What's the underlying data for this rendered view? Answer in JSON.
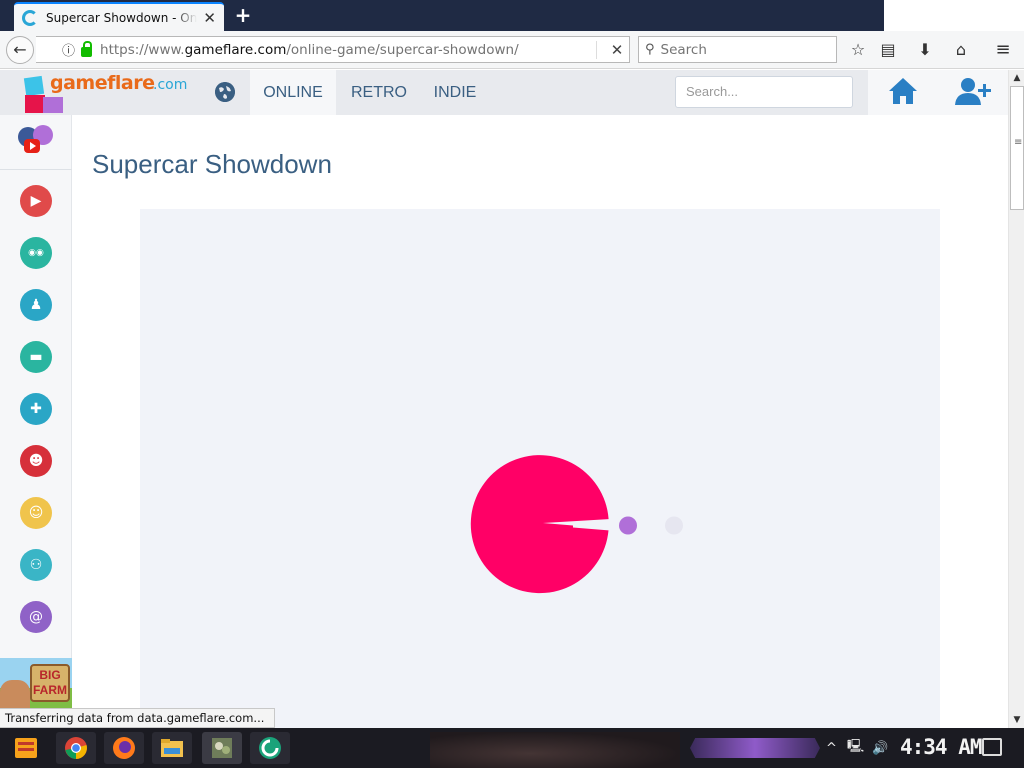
{
  "browser": {
    "tab_title": "Supercar Showdown - Online",
    "url_prefix": "https://www.",
    "url_host": "gameflare.com",
    "url_path": "/online-game/supercar-showdown/",
    "search_placeholder": "Search"
  },
  "site": {
    "logo_text": "gameflare",
    "logo_domain": ".com",
    "nav": [
      "ONLINE",
      "RETRO",
      "INDIE"
    ],
    "search_placeholder": "Search...",
    "colors": {
      "nav_text": "#3a5f82",
      "logo_orange": "#e96a1a",
      "accent_pink": "#ff0066",
      "accent_purple": "#b06fd8"
    }
  },
  "sidebar": {
    "categories": [
      {
        "icon": "play-icon",
        "color": "#e04a4a"
      },
      {
        "icon": "3d-glasses-icon",
        "color": "#2ab5a0"
      },
      {
        "icon": "penguin-icon",
        "color": "#2aa6c6"
      },
      {
        "icon": "car-icon",
        "color": "#2ab5a0"
      },
      {
        "icon": "gamepad-icon",
        "color": "#2aa6c6"
      },
      {
        "icon": "clown-icon",
        "color": "#d6303a"
      },
      {
        "icon": "monkey-icon",
        "color": "#f0c44c"
      },
      {
        "icon": "people-icon",
        "color": "#3ab5c6"
      },
      {
        "icon": "snail-icon",
        "color": "#8f62c7"
      }
    ],
    "ad_text": "BIG FARM"
  },
  "page": {
    "title": "Supercar Showdown"
  },
  "loader": {
    "progress_dots": 2
  },
  "status_bar": {
    "text": "Transferring data from data.gameflare.com..."
  },
  "taskbar": {
    "clock": "4:34 AM"
  }
}
